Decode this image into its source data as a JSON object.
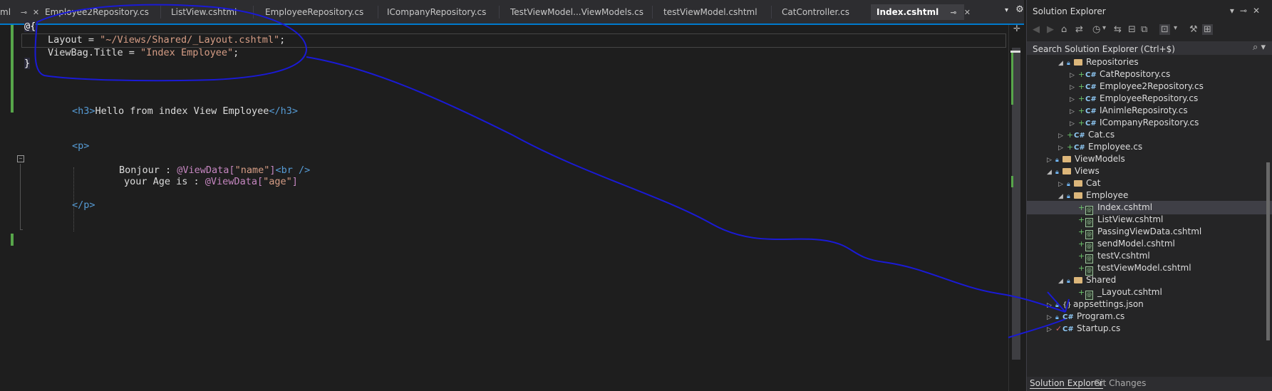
{
  "tabs": [
    {
      "label": "ml",
      "active": false
    },
    {
      "label": "Employee2Repository.cs",
      "active": false
    },
    {
      "label": "ListView.cshtml",
      "active": false
    },
    {
      "label": "EmployeeRepository.cs",
      "active": false
    },
    {
      "label": "ICompanyRepository.cs",
      "active": false
    },
    {
      "label": "TestViewModel...ViewModels.cs",
      "active": false
    },
    {
      "label": "testViewModel.cshtml",
      "active": false
    },
    {
      "label": "CatController.cs",
      "active": false
    },
    {
      "label": "Index.cshtml",
      "active": true
    }
  ],
  "editor": {
    "lines": {
      "l1": "@{",
      "l2a": "Layout = ",
      "l2b": "\"~/Views/Shared/_Layout.cshtml\"",
      "l2c": ";",
      "l3a": "ViewBag.Title = ",
      "l3b": "\"Index Employee\"",
      "l3c": ";",
      "l4": "}",
      "h3open": "<h3>",
      "h3text": "Hello from index View Employee",
      "h3close": "</h3>",
      "popen": "<p>",
      "b1a": "Bonjour : ",
      "b1b": "@ViewData[",
      "b1c": "\"name\"",
      "b1d": "]",
      "b1e": "<br />",
      "b2a": "your Age is : ",
      "b2b": "@ViewData[",
      "b2c": "\"age\"",
      "b2d": "]",
      "pclose": "</p>"
    }
  },
  "solution_explorer": {
    "title": "Solution Explorer",
    "search_placeholder": "Search Solution Explorer (Ctrl+$)",
    "items": [
      {
        "label": "Repositories",
        "kind": "folder"
      },
      {
        "label": "CatRepository.cs",
        "kind": "cs"
      },
      {
        "label": "Employee2Repository.cs",
        "kind": "cs"
      },
      {
        "label": "EmployeeRepository.cs",
        "kind": "cs"
      },
      {
        "label": "IAnimleReposiroty.cs",
        "kind": "cs"
      },
      {
        "label": "ICompanyRepository.cs",
        "kind": "cs"
      },
      {
        "label": "Cat.cs",
        "kind": "cs"
      },
      {
        "label": "Employee.cs",
        "kind": "cs"
      },
      {
        "label": "ViewModels",
        "kind": "folder"
      },
      {
        "label": "Views",
        "kind": "folder"
      },
      {
        "label": "Cat",
        "kind": "folder"
      },
      {
        "label": "Employee",
        "kind": "folder"
      },
      {
        "label": "Index.cshtml",
        "kind": "cshtml",
        "selected": true
      },
      {
        "label": "ListView.cshtml",
        "kind": "cshtml"
      },
      {
        "label": "PassingViewData.cshtml",
        "kind": "cshtml"
      },
      {
        "label": "sendModel.cshtml",
        "kind": "cshtml"
      },
      {
        "label": "testV.cshtml",
        "kind": "cshtml"
      },
      {
        "label": "testViewModel.cshtml",
        "kind": "cshtml"
      },
      {
        "label": "Shared",
        "kind": "folder"
      },
      {
        "label": "_Layout.cshtml",
        "kind": "cshtml"
      },
      {
        "label": "appsettings.json",
        "kind": "json"
      },
      {
        "label": "Program.cs",
        "kind": "cs"
      },
      {
        "label": "Startup.cs",
        "kind": "cs"
      }
    ],
    "bottom_tabs": [
      "Solution Explorer",
      "Git Changes"
    ]
  },
  "colors": {
    "accent": "#007acc",
    "annotation": "#1a1ad6",
    "change_bar": "#57a64a"
  }
}
